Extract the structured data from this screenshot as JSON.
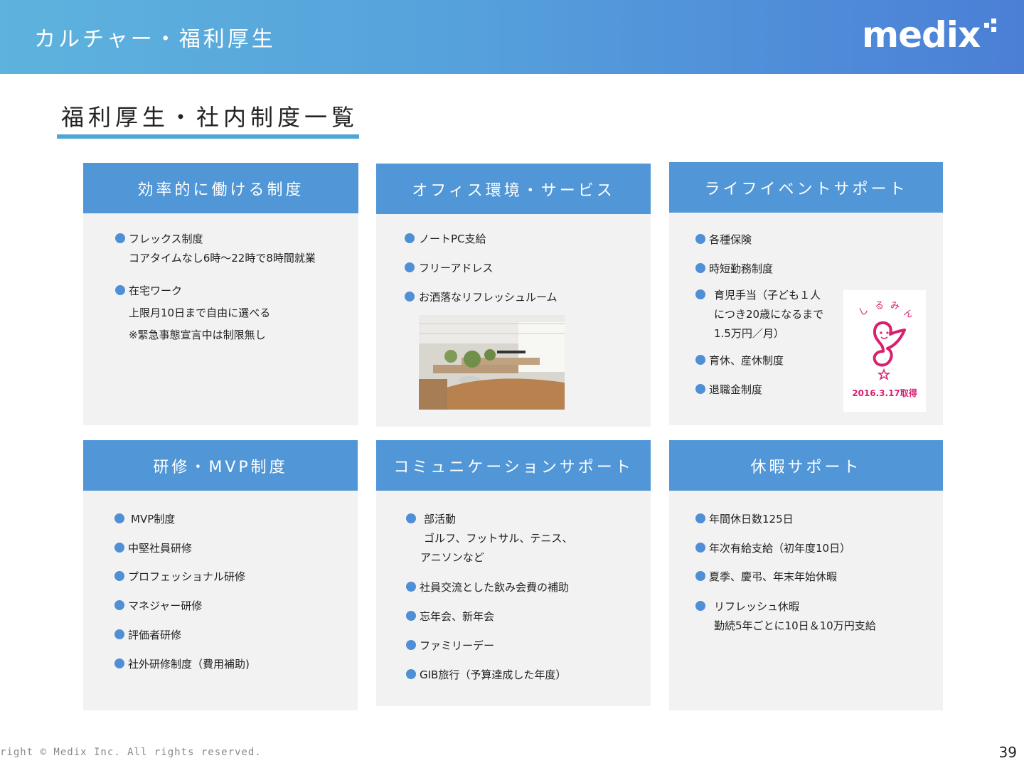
{
  "header": {
    "title": "カルチャー・福利厚生",
    "logo_text": "medix"
  },
  "section": {
    "title": "福利厚生・社内制度一覧"
  },
  "cards": {
    "efficient": {
      "title": "効率的に働ける制度",
      "items": [
        "フレックス制度",
        "コアタイムなし6時～22時で8時間就業",
        "在宅ワーク",
        "上限月10日まで自由に選べる",
        "※緊急事態宣言中は制限無し"
      ]
    },
    "office": {
      "title": "オフィス環境・サービス",
      "items": [
        "ノートPC支給",
        "フリーアドレス",
        "お洒落なリフレッシュルーム"
      ]
    },
    "life": {
      "title": "ライフイベントサポート",
      "items": [
        "各種保険",
        "時短勤務制度",
        "育児手当（子ども１人",
        "につき20歳になるまで",
        "1.5万円／月）",
        "育休、産休制度",
        "退職金制度"
      ],
      "badge_text": "しるみん",
      "badge_caption": "2016.3.17取得"
    },
    "training": {
      "title": "研修・MVP制度",
      "items": [
        "MVP制度",
        "中堅社員研修",
        "プロフェッショナル研修",
        "マネジャー研修",
        "評価者研修",
        "社外研修制度（費用補助)"
      ]
    },
    "communication": {
      "title": "コミュニケーションサポート",
      "items": [
        "部活動",
        "ゴルフ、フットサル、テニス、",
        "アニソンなど",
        "社員交流とした飲み会費の補助",
        "忘年会、新年会",
        "ファミリーデー",
        "GIB旅行（予算達成した年度）"
      ]
    },
    "vacation": {
      "title": "休暇サポート",
      "items": [
        "年間休日数125日",
        "年次有給支給（初年度10日）",
        "夏季、慶弔、年末年始休暇",
        "リフレッシュ休暇",
        "勤続5年ごとに10日＆10万円支給"
      ]
    }
  },
  "footer": {
    "copyright": "right © Medix Inc. All rights reserved.",
    "page_number": "39"
  },
  "colors": {
    "header_gradient_start": "#5db3dd",
    "header_gradient_end": "#4b7fd6",
    "card_header": "#5196d6",
    "card_body": "#f2f2f2",
    "bullet": "#4f8fd6",
    "underline": "#4fa6d6",
    "badge_pink": "#d8206f"
  },
  "icons": {
    "bullet": "circle-bullet",
    "badge": "kurumin-mark"
  }
}
